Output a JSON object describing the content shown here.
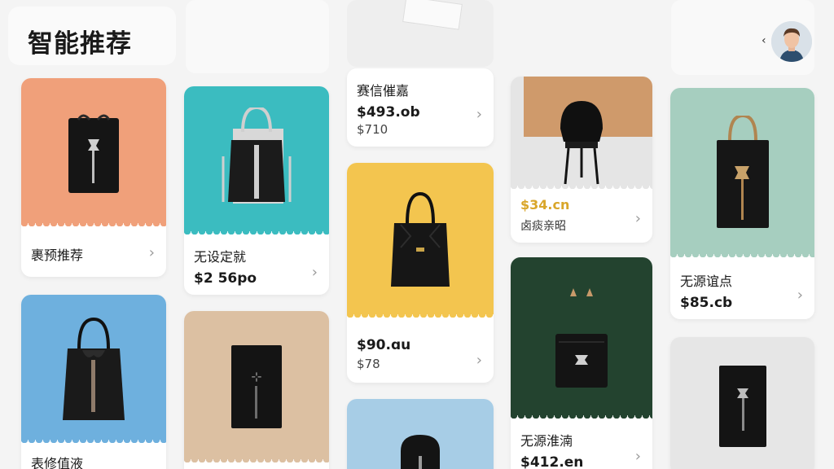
{
  "header": {
    "title": "智能推荐"
  },
  "colors": {
    "orange": "#f0a07a",
    "teal": "#3bbcc0",
    "yellow": "#f3c54f",
    "sage": "#a6cebf",
    "sky": "#6eb0de",
    "tan": "#dcc0a2",
    "forest": "#23432f",
    "grey": "#e6e6e6",
    "accent_price": "#d9a62a"
  },
  "cards": {
    "c1": {
      "name": "裹预推荐"
    },
    "c2": {
      "name": "无设定就",
      "price": "$2 56po"
    },
    "c3": {
      "name": "赛信催嘉",
      "price": "$493.ob",
      "subprice": "$710"
    },
    "c4": {
      "price": "$90.ɑu",
      "subprice": "$78"
    },
    "c5": {
      "price": "$34.cn",
      "sub": "卤痰亲昭"
    },
    "c6": {
      "name": "无源淮湳",
      "price": "$412.en"
    },
    "c7": {
      "name": "无源谊点",
      "price": "$85.cb"
    },
    "c8": {
      "name": "表修值液"
    }
  }
}
